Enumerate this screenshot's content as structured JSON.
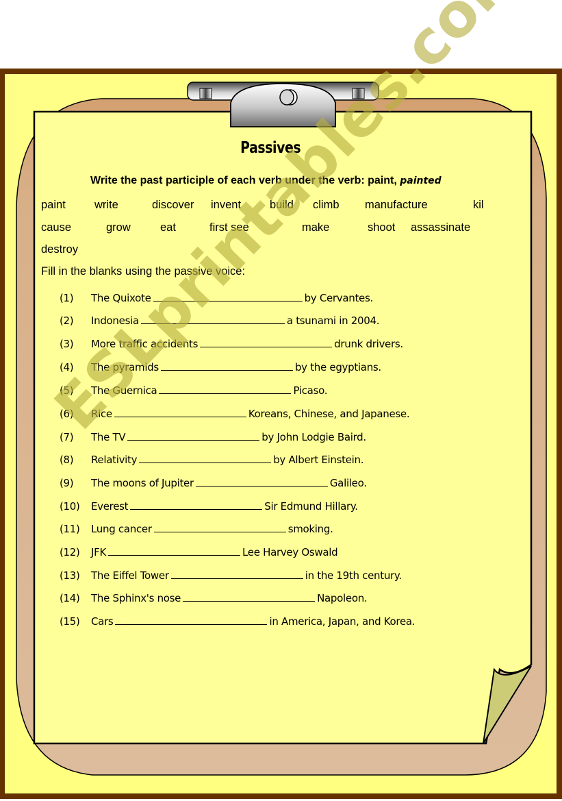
{
  "worksheet": {
    "title": "Passives",
    "instruction": "Write the past participle of each verb under the verb: paint, ",
    "instruction_example": "painted",
    "verbs_row1": [
      "paint",
      "write",
      "discover",
      "invent",
      "build",
      "climb",
      "manufacture",
      "kil"
    ],
    "verbs_row2": [
      "cause",
      "grow",
      "eat",
      "first see",
      "make",
      "shoot",
      "assassinate"
    ],
    "verbs_row3": [
      "destroy"
    ],
    "fill_heading": "Fill in the blanks using the passive voice:",
    "items": [
      {
        "num": "(1)",
        "before": "The Quixote",
        "after": "by Cervantes."
      },
      {
        "num": "(2)",
        "before": "Indonesia",
        "after": "a tsunami in 2004."
      },
      {
        "num": "(3)",
        "before": "More traffic accidents",
        "after": "drunk drivers."
      },
      {
        "num": "(4)",
        "before": "The pyramids",
        "after": "by the egyptians."
      },
      {
        "num": "(5)",
        "before": "The Guernica",
        "after": "Picaso."
      },
      {
        "num": "(6)",
        "before": "Rice",
        "after": "Koreans, Chinese, and Japanese."
      },
      {
        "num": "(7)",
        "before": "The TV",
        "after": "by John Lodgie Baird."
      },
      {
        "num": "(8)",
        "before": "Relativity",
        "after": "by Albert Einstein."
      },
      {
        "num": "(9)",
        "before": "The moons of Jupiter",
        "after": "Galileo."
      },
      {
        "num": "(10)",
        "before": "Everest",
        "after": "Sir Edmund Hillary."
      },
      {
        "num": "(11)",
        "before": "Lung cancer",
        "after": "smoking."
      },
      {
        "num": "(12)",
        "before": "JFK",
        "after": "Lee Harvey Oswald"
      },
      {
        "num": "(13)",
        "before": "The Eiffel Tower",
        "after": "in the 19th century."
      },
      {
        "num": "(14)",
        "before": "The Sphinx's nose",
        "after": "Napoleon."
      },
      {
        "num": "(15)",
        "before": "Cars",
        "after": "in America, Japan, and Korea."
      }
    ]
  },
  "watermark": "ESLprintables.com",
  "colors": {
    "frame": "#663300",
    "background": "#ffff80",
    "board": "#d9b99b",
    "paper": "#ffff99",
    "curl": "#cccc77",
    "watermark": "#b8b040"
  }
}
